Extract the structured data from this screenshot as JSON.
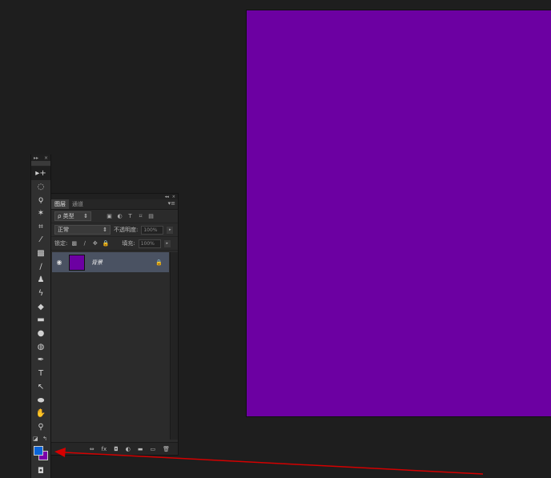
{
  "toolbox": {
    "header_left": "▸▸",
    "header_close": "×",
    "tools": [
      {
        "name": "move-tool",
        "glyph": "▸+"
      },
      {
        "name": "marquee-tool",
        "glyph": "◌"
      },
      {
        "name": "lasso-tool",
        "glyph": "ϙ"
      },
      {
        "name": "magic-wand-tool",
        "glyph": "✶"
      },
      {
        "name": "crop-tool",
        "glyph": "⌗"
      },
      {
        "name": "eyedropper-tool",
        "glyph": "⁄"
      },
      {
        "name": "spot-heal-tool",
        "glyph": "▩"
      },
      {
        "name": "brush-tool",
        "glyph": "∕"
      },
      {
        "name": "stamp-tool",
        "glyph": "♟"
      },
      {
        "name": "history-brush-tool",
        "glyph": "ϟ"
      },
      {
        "name": "eraser-tool",
        "glyph": "◆"
      },
      {
        "name": "gradient-tool",
        "glyph": "▬"
      },
      {
        "name": "blur-tool",
        "glyph": "●"
      },
      {
        "name": "dodge-tool",
        "glyph": "◍"
      },
      {
        "name": "pen-tool",
        "glyph": "✒"
      },
      {
        "name": "type-tool",
        "glyph": "T"
      },
      {
        "name": "path-select-tool",
        "glyph": "↖"
      },
      {
        "name": "ellipse-tool",
        "glyph": "⬬"
      },
      {
        "name": "hand-tool",
        "glyph": "✋"
      },
      {
        "name": "zoom-tool",
        "glyph": "⚲"
      }
    ],
    "fg_color": "#0a64d8",
    "bg_color": "#7b00aa",
    "quickmask_glyph": "◘"
  },
  "layers_panel": {
    "header_collapse": "◂◂",
    "header_close": "×",
    "tabs": [
      "图层",
      "通道"
    ],
    "tab_menu": "▾≡",
    "filter_kind": "ρ 类型",
    "filter_icons": [
      "▣",
      "◐",
      "T",
      "⌑",
      "▤"
    ],
    "blend_mode": "正常",
    "opacity_label": "不透明度:",
    "opacity_value": "100%",
    "lock_label": "锁定:",
    "lock_icons": [
      "▩",
      "∕",
      "✥",
      "🔒"
    ],
    "fill_label": "填充:",
    "fill_value": "100%",
    "layer": {
      "name": "背景",
      "lock": "🔒",
      "thumb_color": "#6c00a2"
    },
    "footer_icons": [
      "⇔",
      "fx",
      "◘",
      "◐",
      "▬",
      "▭",
      "🗑"
    ]
  },
  "canvas": {
    "color": "#6c00a2"
  },
  "annotation": {
    "color": "#d40000"
  }
}
